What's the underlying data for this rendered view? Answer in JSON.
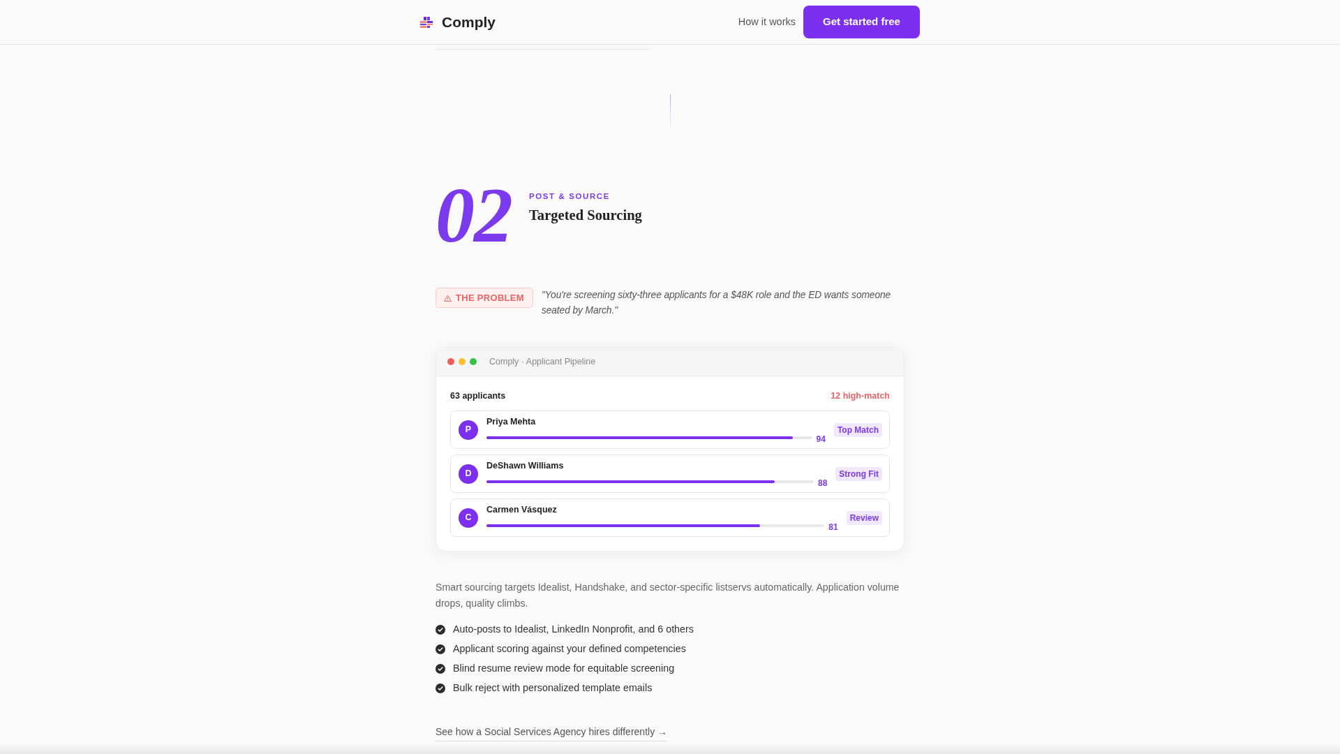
{
  "header": {
    "brand": "Comply",
    "nav_link": "How it works",
    "cta": "Get started free"
  },
  "step": {
    "number": "02",
    "eyebrow": "POST & SOURCE",
    "title": "Targeted Sourcing"
  },
  "problem": {
    "badge": "THE PROBLEM",
    "quote": "\"You're screening sixty-three applicants for a $48K role and the ED wants someone seated by March.\""
  },
  "app_window": {
    "title": "Comply · Applicant Pipeline",
    "count": "63 applicants",
    "highlight": "12 high-match",
    "applicants": [
      {
        "initial": "P",
        "name": "Priya Mehta",
        "level": 0.94,
        "score": "94",
        "tag": "Top Match"
      },
      {
        "initial": "D",
        "name": "DeShawn Williams",
        "level": 0.88,
        "score": "88",
        "tag": "Strong Fit"
      },
      {
        "initial": "C",
        "name": "Carmen Vásquez",
        "level": 0.81,
        "score": "81",
        "tag": "Review"
      }
    ]
  },
  "description": "Smart sourcing targets Idealist, Handshake, and sector-specific listservs automatically. Application volume drops, quality climbs.",
  "features": [
    "Auto-posts to Idealist, LinkedIn Nonprofit, and 6 others",
    "Applicant scoring against your defined competencies",
    "Blind resume review mode for equitable screening",
    "Bulk reject with personalized template emails"
  ],
  "case_study_link": "See how a Social Services Agency hires differently →"
}
